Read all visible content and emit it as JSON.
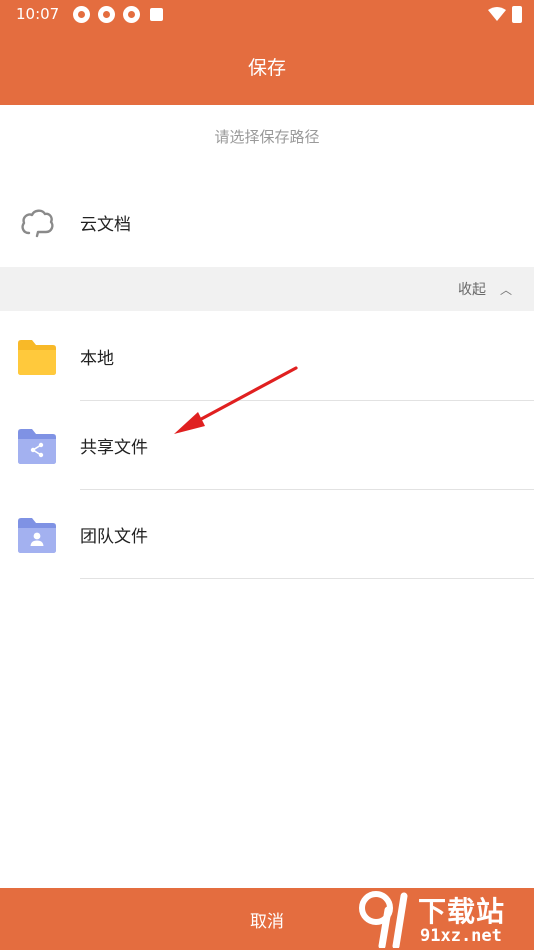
{
  "status_bar": {
    "time": "10:07",
    "icons": [
      "sync-icon",
      "sync-icon",
      "sync-icon",
      "android-app-icon",
      "wifi-icon",
      "battery-charging-icon"
    ]
  },
  "header": {
    "title": "保存"
  },
  "subtitle": "请选择保存路径",
  "locations": {
    "cloud": {
      "label": "云文档",
      "icon": "cloud-icon"
    },
    "collapse": {
      "label": "收起",
      "icon": "chevron-up-icon"
    },
    "items": [
      {
        "label": "本地",
        "icon": "folder-icon"
      },
      {
        "label": "共享文件",
        "icon": "shared-folder-icon"
      },
      {
        "label": "团队文件",
        "icon": "team-folder-icon"
      }
    ]
  },
  "footer": {
    "cancel_label": "取消"
  },
  "watermark": {
    "top": "下载站",
    "bottom": "91xz.net",
    "logo": "91"
  },
  "colors": {
    "accent": "#E46D3F",
    "folder_yellow": "#F8B928",
    "folder_blue": "#8EA0E8",
    "arrow_red": "#E02020"
  }
}
